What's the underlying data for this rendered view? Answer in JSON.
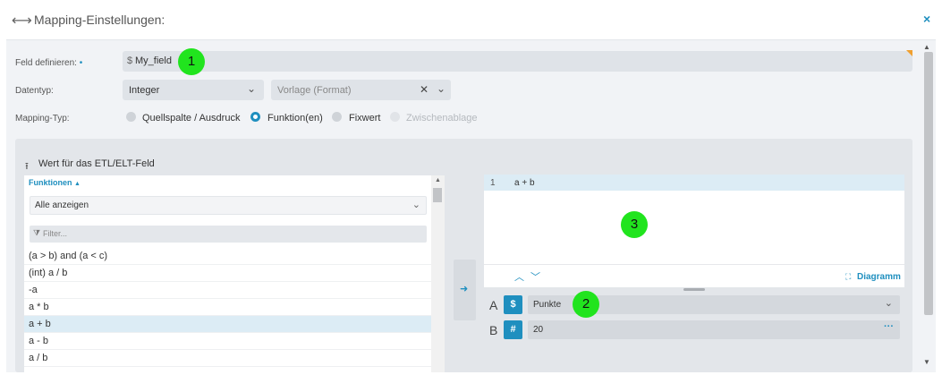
{
  "header": {
    "title": "Mapping-Einstellungen:",
    "icon": "arrows-horizontal-icon",
    "close_icon": "×"
  },
  "form": {
    "field_label": "Feld definieren:",
    "required_mark": "•",
    "field_prefix": "$",
    "field_value": "My_field",
    "datatype_label": "Datentyp:",
    "datatype_value": "Integer",
    "template_placeholder": "Vorlage (Format)",
    "mapping_label": "Mapping-Typ:",
    "mapping_options": [
      {
        "label": "Quellspalte / Ausdruck",
        "state": "off"
      },
      {
        "label": "Funktion(en)",
        "state": "on"
      },
      {
        "label": "Fixwert",
        "state": "off"
      },
      {
        "label": "Zwischenablage",
        "state": "disabled"
      }
    ]
  },
  "etl": {
    "title": "Wert für das ETL/ELT-Feld",
    "functions": {
      "header": "Funktionen",
      "sort_indicator": "▲",
      "filter_select": "Alle anzeigen",
      "search_placeholder": "Filter...",
      "items": [
        {
          "label": "(a > b) and (a < c)",
          "selected": false
        },
        {
          "label": "(int) a / b",
          "selected": false
        },
        {
          "label": "-a",
          "selected": false
        },
        {
          "label": "a * b",
          "selected": false
        },
        {
          "label": "a + b",
          "selected": true
        },
        {
          "label": "a - b",
          "selected": false
        },
        {
          "label": "a / b",
          "selected": false
        }
      ]
    },
    "editor": {
      "line_number": "1",
      "code": "a + b",
      "diagram_label": "Diagramm"
    },
    "params": [
      {
        "letter": "A",
        "type_symbol": "$",
        "value": "Punkte",
        "tail": "⌄"
      },
      {
        "letter": "B",
        "type_symbol": "#",
        "value": "20",
        "tail": "···"
      }
    ]
  },
  "markers": [
    "1",
    "2",
    "3"
  ],
  "colors": {
    "accent": "#1f8fbf",
    "marker": "#21e41e"
  }
}
